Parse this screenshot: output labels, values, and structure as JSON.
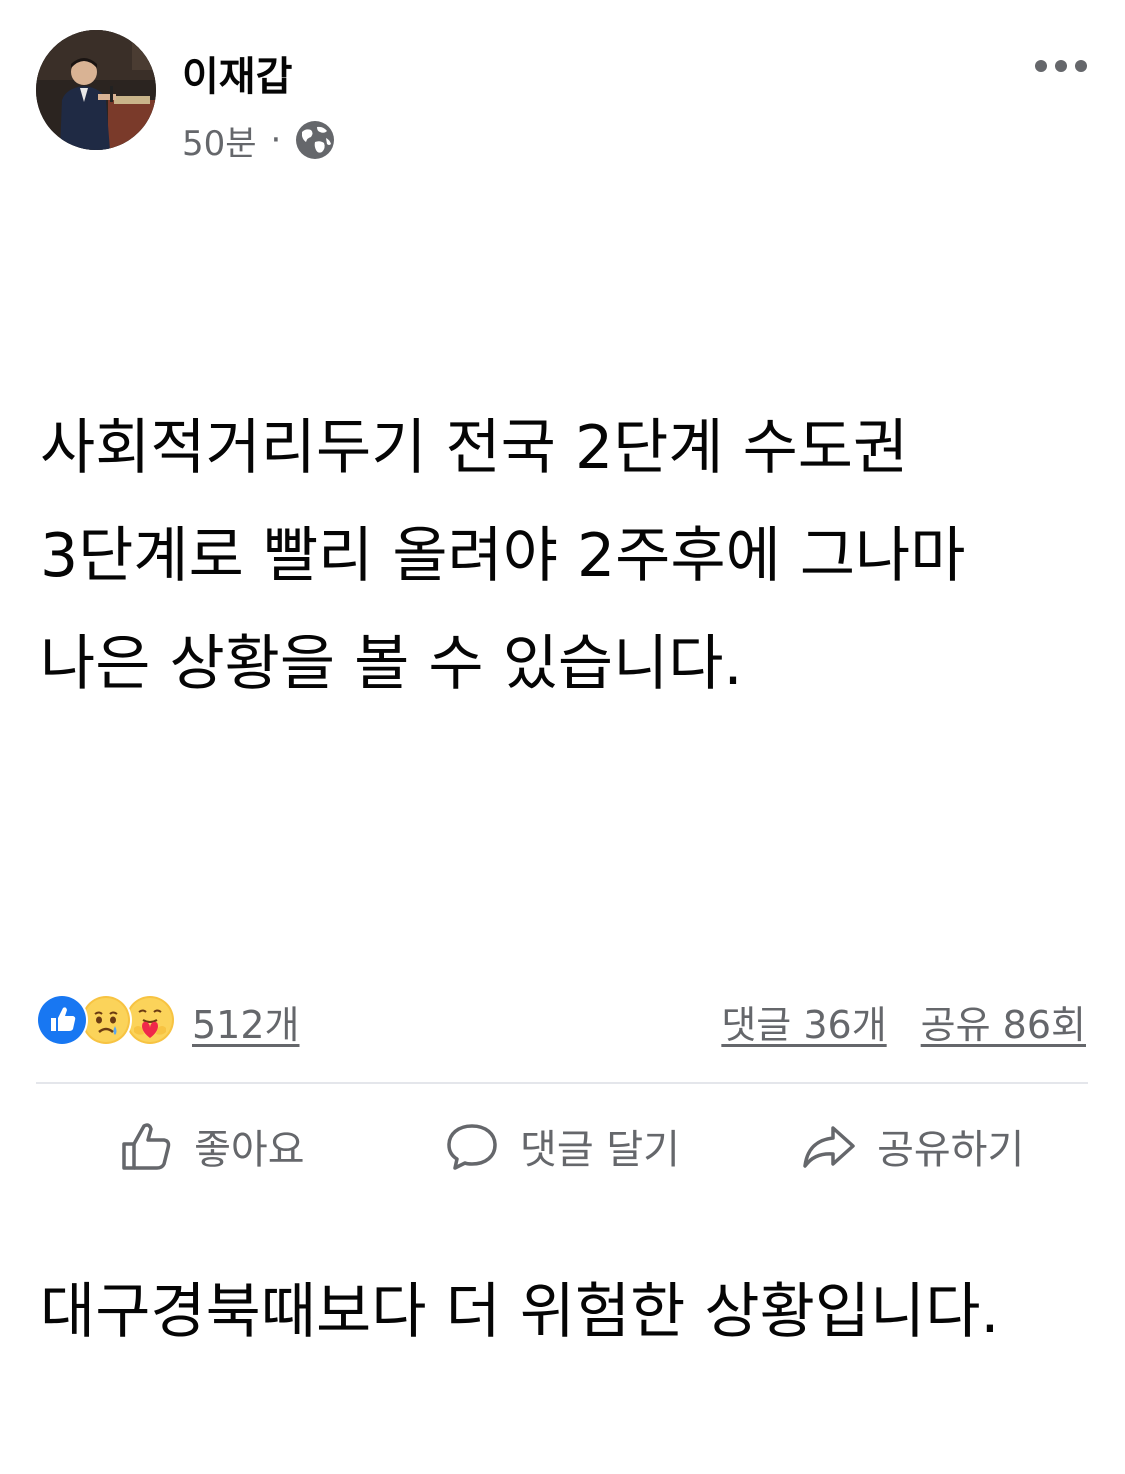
{
  "post": {
    "author": "이재갑",
    "time": "50분",
    "separator": "·",
    "privacy_icon": "globe-icon",
    "more_icon": "more-options-icon",
    "paragraphs": [
      "사회적거리두기 전국 2단계 수도권 3단계로 빨리 올려야 2주후에 그나마 나은 상황을 볼 수 있습니다.",
      "대구경북때보다 더 위험한 상황입니다."
    ]
  },
  "reactions": {
    "icons": [
      "like-reaction-icon",
      "sad-reaction-icon",
      "care-reaction-icon"
    ],
    "count": "512개",
    "comments": "댓글 36개",
    "shares": "공유 86회"
  },
  "actions": {
    "like": {
      "label": "좋아요",
      "icon": "thumbs-up-icon"
    },
    "comment": {
      "label": "댓글 달기",
      "icon": "comment-bubble-icon"
    },
    "share": {
      "label": "공유하기",
      "icon": "share-arrow-icon"
    }
  },
  "colors": {
    "text": "#050505",
    "secondary": "#65676b",
    "like_blue": "#1877f2",
    "divider": "#e4e6eb"
  }
}
